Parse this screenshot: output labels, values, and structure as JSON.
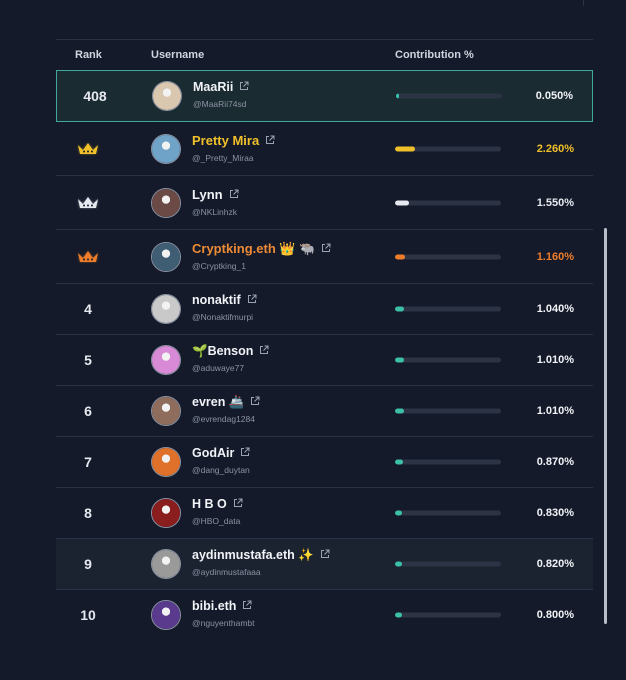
{
  "header": {
    "rank": "Rank",
    "username": "Username",
    "contribution": "Contribution %"
  },
  "rows": [
    {
      "rank": "408",
      "name": "MaaRii",
      "handle": "@MaaRii74sd",
      "pct": "0.050%",
      "share": 0.05,
      "color": "#3cc0a8",
      "name_color": "#f1f3f7",
      "avatar": "#d9c7b0",
      "crown": null
    },
    {
      "rank": "",
      "name": "Pretty Mira",
      "handle": "@_Pretty_Miraa",
      "pct": "2.260%",
      "share": 2.26,
      "color": "#f0c02a",
      "name_color": "#f0c02a",
      "avatar": "#6fa3c8",
      "crown": "gold"
    },
    {
      "rank": "",
      "name": "Lynn",
      "handle": "@NKLinhzk",
      "pct": "1.550%",
      "share": 1.55,
      "color": "#e6e9ef",
      "name_color": "#f1f3f7",
      "avatar": "#6b4a46",
      "crown": "silver"
    },
    {
      "rank": "",
      "name": "Cryptking.eth 👑 🐃",
      "handle": "@Cryptking_1",
      "pct": "1.160%",
      "share": 1.16,
      "color": "#ee7d2b",
      "name_color": "#ee8a36",
      "avatar": "#3f5d73",
      "crown": "bronze"
    },
    {
      "rank": "4",
      "name": "nonaktif",
      "handle": "@Nonaktifmurpi",
      "pct": "1.040%",
      "share": 1.04,
      "color": "#3cc0a8",
      "name_color": "#f1f3f7",
      "avatar": "#c9c9c9",
      "crown": null
    },
    {
      "rank": "5",
      "name": "🌱Benson",
      "handle": "@aduwaye77",
      "pct": "1.010%",
      "share": 1.01,
      "color": "#3cc0a8",
      "name_color": "#f1f3f7",
      "avatar": "#d98ad6",
      "crown": null
    },
    {
      "rank": "6",
      "name": "evren 🚢",
      "handle": "@evrendag1284",
      "pct": "1.010%",
      "share": 1.01,
      "color": "#3cc0a8",
      "name_color": "#f1f3f7",
      "avatar": "#8e6d5c",
      "crown": null
    },
    {
      "rank": "7",
      "name": "GodAir",
      "handle": "@dang_duytan",
      "pct": "0.870%",
      "share": 0.87,
      "color": "#3cc0a8",
      "name_color": "#f1f3f7",
      "avatar": "#e0712a",
      "crown": null
    },
    {
      "rank": "8",
      "name": "H B O",
      "handle": "@HBO_data",
      "pct": "0.830%",
      "share": 0.83,
      "color": "#3cc0a8",
      "name_color": "#f1f3f7",
      "avatar": "#8a1d1d",
      "crown": null
    },
    {
      "rank": "9",
      "name": "aydinmustafa.eth ✨",
      "handle": "@aydinmustafaaa",
      "pct": "0.820%",
      "share": 0.82,
      "color": "#3cc0a8",
      "name_color": "#f1f3f7",
      "avatar": "#9a9a9a",
      "crown": null
    },
    {
      "rank": "10",
      "name": "bibi.eth",
      "handle": "@nguyenthambt",
      "pct": "0.800%",
      "share": 0.8,
      "color": "#3cc0a8",
      "name_color": "#f1f3f7",
      "avatar": "#5a3a8c",
      "crown": null
    }
  ],
  "icons": {
    "external_link": "external-link-icon",
    "crown": "crown-icon"
  },
  "crown_colors": {
    "gold": "#f0c02a",
    "silver": "#e6e9ef",
    "bronze": "#ee7d2b"
  }
}
